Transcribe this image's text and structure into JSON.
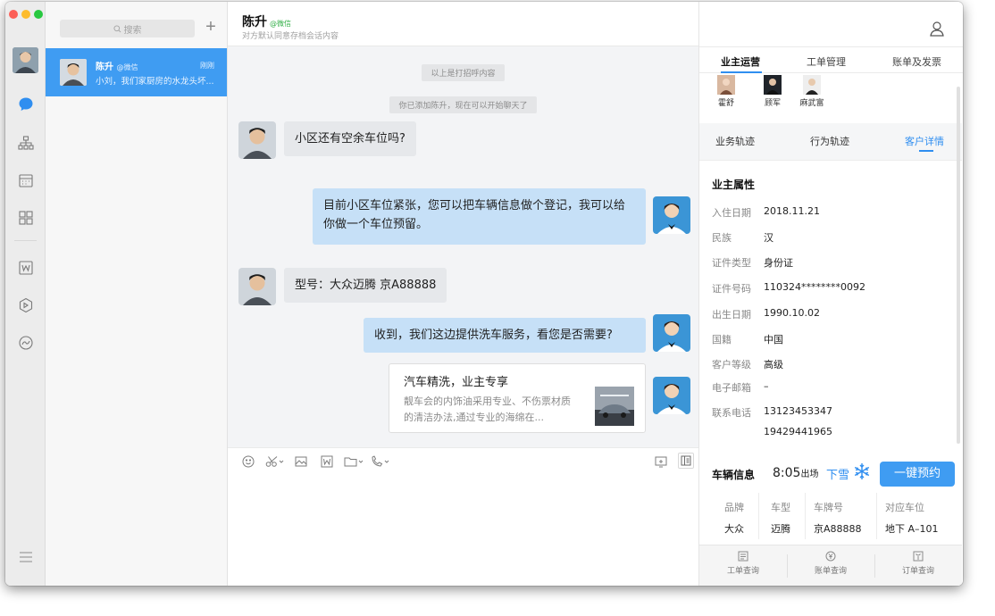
{
  "colors": {
    "accent": "#3f9cf2",
    "wechat_green": "#35b04a",
    "out_bubble": "#c6e0f7",
    "in_bubble": "#e6e8eb"
  },
  "conversation_list": {
    "search_placeholder": "搜索",
    "items": [
      {
        "name": "陈升",
        "tag": "@微信",
        "time": "刚刚",
        "preview": "小刘，我们家厨房的水龙头坏..."
      }
    ]
  },
  "chat": {
    "title": "陈升",
    "title_tag": "@微信",
    "subtitle": "对方默认同意存档会话内容",
    "system_messages": [
      "以上是打招呼内容",
      "你已添加陈升，现在可以开始聊天了"
    ],
    "messages": [
      {
        "side": "in",
        "text": "小区还有空余车位吗?"
      },
      {
        "side": "out",
        "text": "目前小区车位紧张，您可以把车辆信息做个登记，我可以给你做一个车位预留。"
      },
      {
        "side": "in",
        "text": "型号：大众迈腾 京A88888"
      },
      {
        "side": "out",
        "text": "收到，我们这边提供洗车服务，看您是否需要?"
      }
    ],
    "card": {
      "title": "汽车精洗，业主专享",
      "desc": "靓车会的内饰油采用专业、不伤票材质的清洁办法,通过专业的海绵在..."
    }
  },
  "right_panel": {
    "tabs": [
      "业主运营",
      "工单管理",
      "账单及发票"
    ],
    "staff": [
      "霍舒",
      "顾军",
      "麻武富"
    ],
    "subtabs": [
      "业务轨迹",
      "行为轨迹",
      "客户详情"
    ],
    "owner_section_title": "业主属性",
    "attributes": [
      {
        "key": "入住日期",
        "value": "2018.11.21"
      },
      {
        "key": "民族",
        "value": "汉"
      },
      {
        "key": "证件类型",
        "value": "身份证"
      },
      {
        "key": "证件号码",
        "value": "110324********0092"
      },
      {
        "key": "出生日期",
        "value": "1990.10.02"
      },
      {
        "key": "国籍",
        "value": "中国"
      },
      {
        "key": "客户等级",
        "value": "高级"
      },
      {
        "key": "电子邮箱",
        "value": "–"
      },
      {
        "key": "联系电话",
        "value": "13123453347"
      },
      {
        "key": "",
        "value": "19429441965"
      }
    ],
    "vehicle": {
      "title": "车辆信息",
      "time": "8:05",
      "time_suffix": "出场",
      "weather": "下雪",
      "book_button": "一键预约",
      "columns": [
        "品牌",
        "车型",
        "车牌号",
        "对应车位"
      ],
      "values": [
        "大众",
        "迈腾",
        "京A88888",
        "地下 A–101"
      ]
    },
    "bottom_nav": [
      "工单查询",
      "账单查询",
      "订单查询"
    ]
  }
}
